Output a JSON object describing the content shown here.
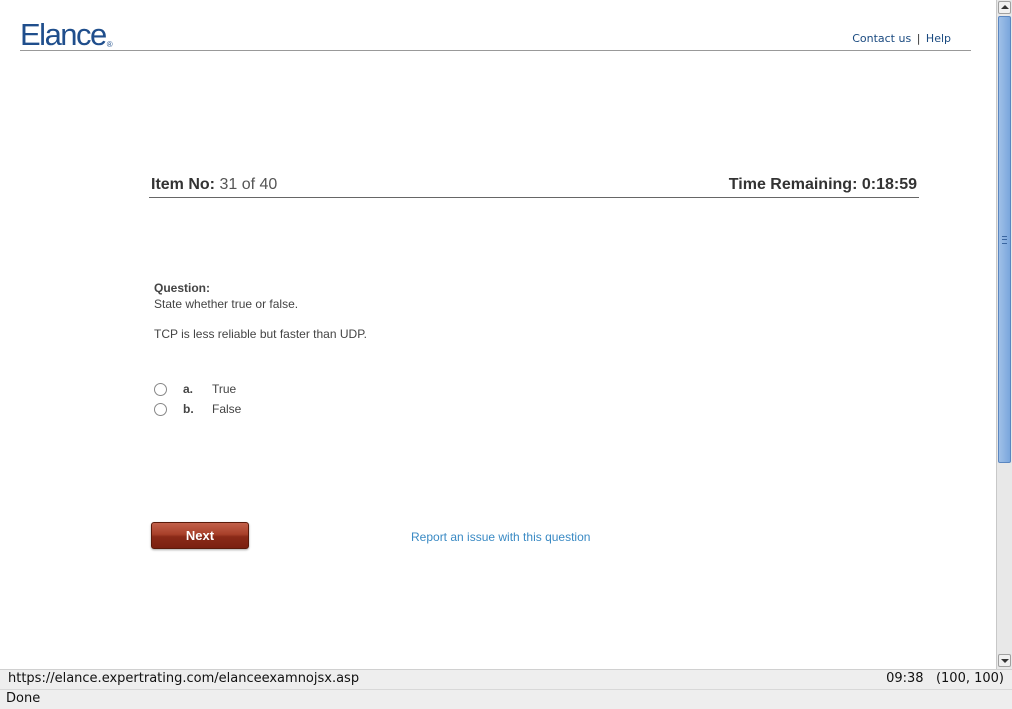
{
  "header": {
    "logo_text": "Elance",
    "logo_mark": "®",
    "contact_label": "Contact us",
    "separator": "|",
    "help_label": "Help"
  },
  "item": {
    "label": "Item No:",
    "value": "31 of 40",
    "time_remaining": "Time Remaining: 0:18:59"
  },
  "question": {
    "label": "Question:",
    "instruction": "State whether true or false.",
    "text": "TCP is less reliable but faster than UDP."
  },
  "options": [
    {
      "letter": "a.",
      "text": "True",
      "selected": false
    },
    {
      "letter": "b.",
      "text": "False",
      "selected": false
    }
  ],
  "actions": {
    "next_label": "Next",
    "report_label": "Report an issue with this question"
  },
  "browser": {
    "url": "https://elance.expertrating.com/elanceexamnojsx.asp",
    "status_right": "09:38   (100, 100)",
    "status": "Done"
  },
  "colors": {
    "logo": "#1f4e8c",
    "link": "#3a8ac4",
    "next_button": "#a8402a"
  }
}
